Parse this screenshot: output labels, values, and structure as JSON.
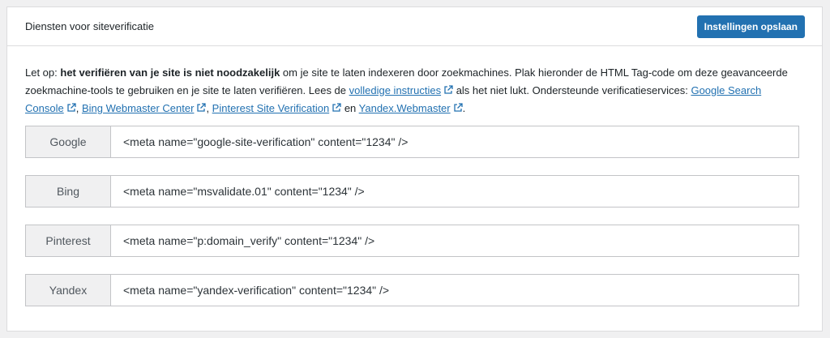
{
  "header": {
    "title": "Diensten voor siteverificatie",
    "save_label": "Instellingen opslaan"
  },
  "intro": {
    "prefix": "Let op: ",
    "bold": "het verifiëren van je site is niet noodzakelijk",
    "text1": " om je site te laten indexeren door zoekmachines. Plak hieronder de HTML Tag-code om deze geavanceerde zoekmachine-tools te gebruiken en je site te laten verifiëren. Lees de ",
    "link_instructions": "volledige instructies",
    "text2": " als het niet lukt. Ondersteunde verificatieservices: ",
    "link_google": "Google Search Console",
    "sep1": ", ",
    "link_bing": "Bing Webmaster Center",
    "sep2": ", ",
    "link_pinterest": "Pinterest Site Verification",
    "sep3": " en ",
    "link_yandex": "Yandex.Webmaster",
    "end": "."
  },
  "services": [
    {
      "label": "Google",
      "value": "<meta name=\"google-site-verification\" content=\"1234\" />"
    },
    {
      "label": "Bing",
      "value": "<meta name=\"msvalidate.01\" content=\"1234\" />"
    },
    {
      "label": "Pinterest",
      "value": "<meta name=\"p:domain_verify\" content=\"1234\" />"
    },
    {
      "label": "Yandex",
      "value": "<meta name=\"yandex-verification\" content=\"1234\" />"
    }
  ],
  "colors": {
    "primary": "#2271b1",
    "link": "#2271b1",
    "label_bg": "#f0f0f1"
  },
  "icons": {
    "external": "external-link-icon"
  }
}
